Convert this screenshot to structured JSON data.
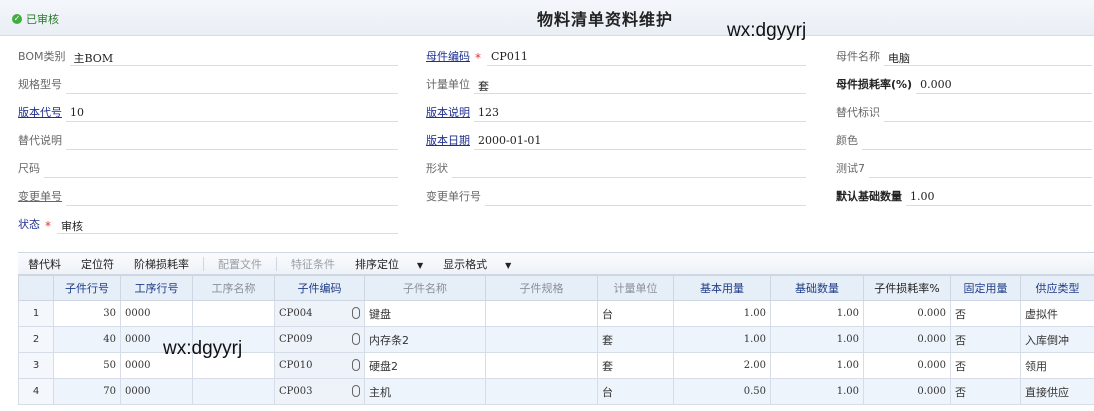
{
  "header": {
    "status": "已审核",
    "title": "物料清单资料维护",
    "watermark": "wx:dgyyrj",
    "watermark2": "wx:dgyyrj"
  },
  "form": {
    "bom_type": {
      "label": "BOM类别",
      "value": "主BOM"
    },
    "spec": {
      "label": "规格型号",
      "value": ""
    },
    "version_code": {
      "label": "版本代号",
      "value": "10"
    },
    "sub_desc": {
      "label": "替代说明",
      "value": ""
    },
    "size": {
      "label": "尺码",
      "value": ""
    },
    "change_no": {
      "label": "变更单号",
      "value": ""
    },
    "status": {
      "label": "状态",
      "value": "审核"
    },
    "parent_code": {
      "label": "母件编码",
      "value": "CP011"
    },
    "unit": {
      "label": "计量单位",
      "value": "套"
    },
    "version_desc": {
      "label": "版本说明",
      "value": "123"
    },
    "version_date": {
      "label": "版本日期",
      "value": "2000-01-01"
    },
    "shape": {
      "label": "形状",
      "value": ""
    },
    "change_row": {
      "label": "变更单行号",
      "value": ""
    },
    "parent_name": {
      "label": "母件名称",
      "value": "电脑"
    },
    "parent_loss": {
      "label": "母件损耗率(%)",
      "value": "0.000"
    },
    "sub_flag": {
      "label": "替代标识",
      "value": ""
    },
    "color": {
      "label": "颜色",
      "value": ""
    },
    "test7": {
      "label": "测试7",
      "value": ""
    },
    "default_qty": {
      "label": "默认基础数量",
      "value": "1.00"
    }
  },
  "toolbar": {
    "items": [
      "替代料",
      "定位符",
      "阶梯损耗率",
      "配置文件",
      "特征条件",
      "排序定位",
      "显示格式"
    ]
  },
  "grid": {
    "columns": [
      "",
      "子件行号",
      "工序行号",
      "工序名称",
      "子件编码",
      "子件名称",
      "子件规格",
      "计量单位",
      "基本用量",
      "基础数量",
      "子件损耗率%",
      "固定用量",
      "供应类型"
    ],
    "rows": [
      {
        "no": "1",
        "line": "30",
        "op": "0000",
        "op_name": "",
        "code": "CP004",
        "name": "键盘",
        "spec": "",
        "unit": "台",
        "base": "1.00",
        "basis": "1.00",
        "loss": "0.000",
        "fixed": "否",
        "supply": "虚拟件"
      },
      {
        "no": "2",
        "line": "40",
        "op": "0000",
        "op_name": "",
        "code": "CP009",
        "name": "内存条2",
        "spec": "",
        "unit": "套",
        "base": "1.00",
        "basis": "1.00",
        "loss": "0.000",
        "fixed": "否",
        "supply": "入库倒冲"
      },
      {
        "no": "3",
        "line": "50",
        "op": "0000",
        "op_name": "",
        "code": "CP010",
        "name": "硬盘2",
        "spec": "",
        "unit": "套",
        "base": "2.00",
        "basis": "1.00",
        "loss": "0.000",
        "fixed": "否",
        "supply": "领用"
      },
      {
        "no": "4",
        "line": "70",
        "op": "0000",
        "op_name": "",
        "code": "CP003",
        "name": "主机",
        "spec": "",
        "unit": "台",
        "base": "0.50",
        "basis": "1.00",
        "loss": "0.000",
        "fixed": "否",
        "supply": "直接供应"
      }
    ]
  }
}
